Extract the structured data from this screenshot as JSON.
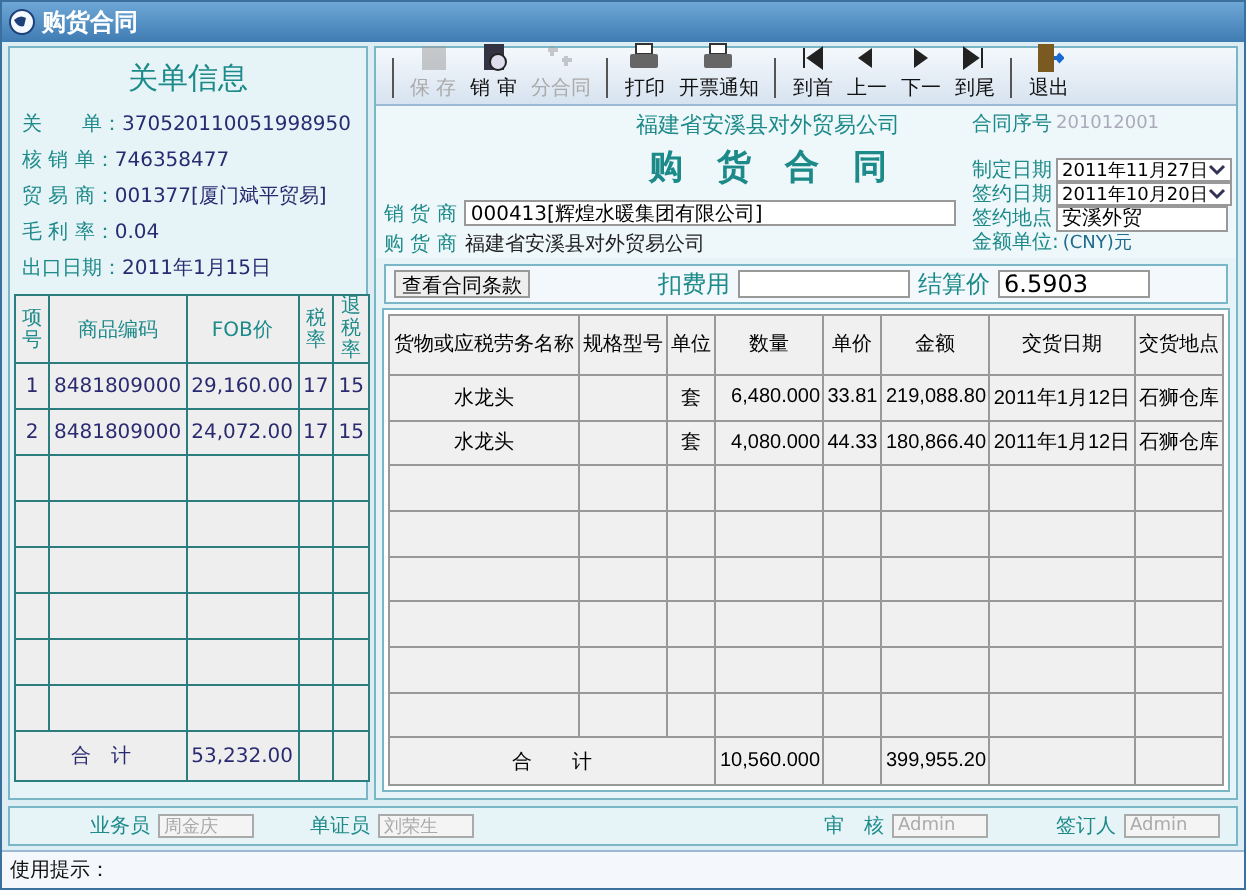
{
  "window": {
    "title": "购货合同"
  },
  "customs_info": {
    "title": "关单信息",
    "fields": [
      {
        "label": "关　　单：",
        "value": "370520110051998950"
      },
      {
        "label": "核 销 单：",
        "value": "746358477"
      },
      {
        "label": "贸 易 商：",
        "value": "001377[厦门斌平贸易]"
      },
      {
        "label": "毛 利 率：",
        "value": "0.04"
      },
      {
        "label": "出口日期：",
        "value": "2011年1月15日"
      }
    ],
    "table": {
      "columns": [
        "项号",
        "商品编码",
        "FOB价",
        "税率",
        "退税率"
      ],
      "rows": [
        {
          "cells": [
            "1",
            "8481809000",
            "29,160.00",
            "17",
            "15"
          ]
        },
        {
          "cells": [
            "2",
            "8481809000",
            "24,072.00",
            "17",
            "15"
          ]
        }
      ],
      "total": {
        "label": "合　计",
        "value": "53,232.00"
      }
    }
  },
  "toolbar": {
    "groups": [
      [
        {
          "label": "保 存",
          "disabled": true
        },
        {
          "label": "销 审",
          "disabled": false
        },
        {
          "label": "分合同",
          "disabled": true
        }
      ],
      [
        {
          "label": "打印",
          "disabled": false
        },
        {
          "label": "开票通知",
          "disabled": false
        }
      ],
      [
        {
          "label": "到首",
          "disabled": false
        },
        {
          "label": "上一",
          "disabled": false
        },
        {
          "label": "下一",
          "disabled": false
        },
        {
          "label": "到尾",
          "disabled": false
        }
      ],
      [
        {
          "label": "退出",
          "disabled": false
        }
      ]
    ]
  },
  "contract": {
    "company": "福建省安溪县对外贸易公司",
    "title": "购　货　合　同",
    "parties": [
      {
        "kind": "input",
        "label": "销 货 商",
        "value": "000413[辉煌水暖集团有限公司]"
      },
      {
        "kind": "text",
        "label": "购 货 商",
        "value": "福建省安溪县对外贸易公司"
      }
    ],
    "meta": [
      {
        "kind": "text",
        "label": "合同序号",
        "value": "201012001"
      },
      {
        "kind": "dropdown",
        "label": "制定日期",
        "value": "2011年11月27日"
      },
      {
        "kind": "dropdown",
        "label": "签约日期",
        "value": "2011年10月20日"
      },
      {
        "kind": "input",
        "label": "签约地点",
        "value": "安溪外贸"
      },
      {
        "kind": "text",
        "label": "金额单位:",
        "value": "(CNY)元"
      }
    ]
  },
  "fees": {
    "terms_button": "查看合同条款",
    "deduction": {
      "label": "扣费用"
    },
    "settlement": {
      "label": "结算价",
      "value": "6.5903"
    }
  },
  "goods_table": {
    "columns": [
      "货物或应税劳务名称",
      "规格型号",
      "单位",
      "数量",
      "单价",
      "金额",
      "交货日期",
      "交货地点"
    ],
    "rows": [
      {
        "cells": [
          "水龙头",
          "",
          "套",
          "6,480.000",
          "33.81",
          "219,088.80",
          "2011年1月12日",
          "石狮仓库"
        ]
      },
      {
        "cells": [
          "水龙头",
          "",
          "套",
          "4,080.000",
          "44.33",
          "180,866.40",
          "2011年1月12日",
          "石狮仓库"
        ]
      }
    ],
    "total": {
      "label": "合　　计",
      "quantity": "10,560.000",
      "amount": "399,955.20"
    }
  },
  "staff": [
    {
      "label": "业务员",
      "value": "周金庆",
      "disabled": true
    },
    {
      "label": "单证员",
      "value": "刘荣生",
      "disabled": true
    },
    {
      "label": "审　核",
      "value": "Admin",
      "disabled": true
    },
    {
      "label": "签订人",
      "value": "Admin",
      "disabled": true
    }
  ],
  "status_bar": {
    "label": "使用提示："
  }
}
